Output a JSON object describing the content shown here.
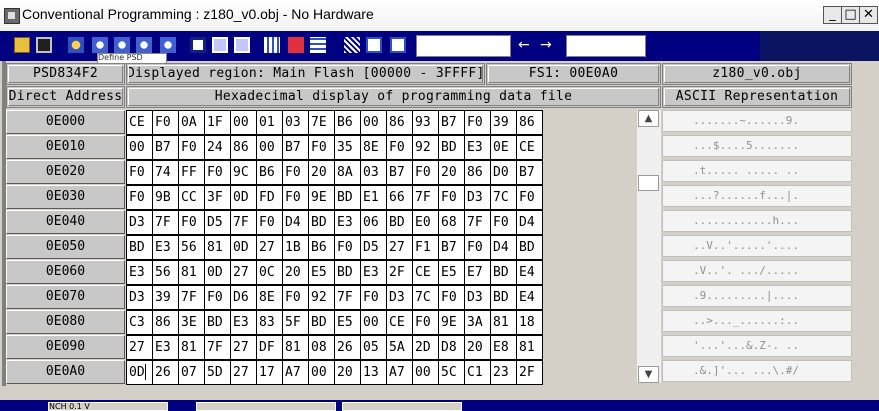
{
  "window": {
    "title": "Conventional Programming : z180_v0.obj - No Hardware",
    "minimize": "_",
    "maximize": "□",
    "close": "✕"
  },
  "toolbar": {
    "icons": [
      "open-folder-icon",
      "save-icon",
      "settings-gear-icon",
      "gear-icon",
      "gear-icon",
      "gear-icon",
      "chip-icon",
      "chip-icon",
      "chip-icon",
      "grid-icon",
      "grid-icon",
      "grid-icon",
      "grid-icon",
      "filter-icon",
      "ff-icon",
      "find-icon"
    ],
    "tooltip_stub": "Define PSD",
    "nav_back": "←",
    "nav_forward": "→",
    "find_value": "",
    "goto_value": ""
  },
  "info": {
    "device": "PSD834F2",
    "region": "Displayed region: Main Flash [00000 - 3FFFF]",
    "fs": "FS1: 00E0A0",
    "file": "z180_v0.obj"
  },
  "headers": {
    "address": "Direct Address",
    "hex": "Hexadecimal display of programming data file",
    "ascii": "ASCII Representation"
  },
  "rows": [
    {
      "address": "0E000",
      "bytes": [
        "CE",
        "F0",
        "0A",
        "1F",
        "00",
        "01",
        "03",
        "7E",
        "B6",
        "00",
        "86",
        "93",
        "B7",
        "F0",
        "39",
        "86"
      ],
      "ascii": ".......~......9."
    },
    {
      "address": "0E010",
      "bytes": [
        "00",
        "B7",
        "F0",
        "24",
        "86",
        "00",
        "B7",
        "F0",
        "35",
        "8E",
        "F0",
        "92",
        "BD",
        "E3",
        "0E",
        "CE"
      ],
      "ascii": "...$....5......."
    },
    {
      "address": "0E020",
      "bytes": [
        "F0",
        "74",
        "FF",
        "F0",
        "9C",
        "B6",
        "F0",
        "20",
        "8A",
        "03",
        "B7",
        "F0",
        "20",
        "86",
        "D0",
        "B7"
      ],
      "ascii": ".t..... ..... .."
    },
    {
      "address": "0E030",
      "bytes": [
        "F0",
        "9B",
        "CC",
        "3F",
        "0D",
        "FD",
        "F0",
        "9E",
        "BD",
        "E1",
        "66",
        "7F",
        "F0",
        "D3",
        "7C",
        "F0"
      ],
      "ascii": "...?......f...|."
    },
    {
      "address": "0E040",
      "bytes": [
        "D3",
        "7F",
        "F0",
        "D5",
        "7F",
        "F0",
        "D4",
        "BD",
        "E3",
        "06",
        "BD",
        "E0",
        "68",
        "7F",
        "F0",
        "D4"
      ],
      "ascii": "............h..."
    },
    {
      "address": "0E050",
      "bytes": [
        "BD",
        "E3",
        "56",
        "81",
        "0D",
        "27",
        "1B",
        "B6",
        "F0",
        "D5",
        "27",
        "F1",
        "B7",
        "F0",
        "D4",
        "BD"
      ],
      "ascii": "..V..'.....'...."
    },
    {
      "address": "0E060",
      "bytes": [
        "E3",
        "56",
        "81",
        "0D",
        "27",
        "0C",
        "20",
        "E5",
        "BD",
        "E3",
        "2F",
        "CE",
        "E5",
        "E7",
        "BD",
        "E4"
      ],
      "ascii": ".V..'. .../....."
    },
    {
      "address": "0E070",
      "bytes": [
        "D3",
        "39",
        "7F",
        "F0",
        "D6",
        "8E",
        "F0",
        "92",
        "7F",
        "F0",
        "D3",
        "7C",
        "F0",
        "D3",
        "BD",
        "E4"
      ],
      "ascii": ".9.........|...."
    },
    {
      "address": "0E080",
      "bytes": [
        "C3",
        "86",
        "3E",
        "BD",
        "E3",
        "83",
        "5F",
        "BD",
        "E5",
        "00",
        "CE",
        "F0",
        "9E",
        "3A",
        "81",
        "18"
      ],
      "ascii": "..>..._......:.."
    },
    {
      "address": "0E090",
      "bytes": [
        "27",
        "E3",
        "81",
        "7F",
        "27",
        "DF",
        "81",
        "08",
        "26",
        "05",
        "5A",
        "2D",
        "D8",
        "20",
        "E8",
        "81"
      ],
      "ascii": "'...'...&.Z-. .."
    },
    {
      "address": "0E0A0",
      "bytes": [
        "0D",
        "26",
        "07",
        "5D",
        "27",
        "17",
        "A7",
        "00",
        "20",
        "13",
        "A7",
        "00",
        "5C",
        "C1",
        "23",
        "2F"
      ],
      "ascii": ".&.]'... ...\\.#/"
    }
  ],
  "scroll": {
    "up": "▲",
    "down": "▼"
  },
  "taskbar": {
    "item": "NCH 0.1 V"
  }
}
